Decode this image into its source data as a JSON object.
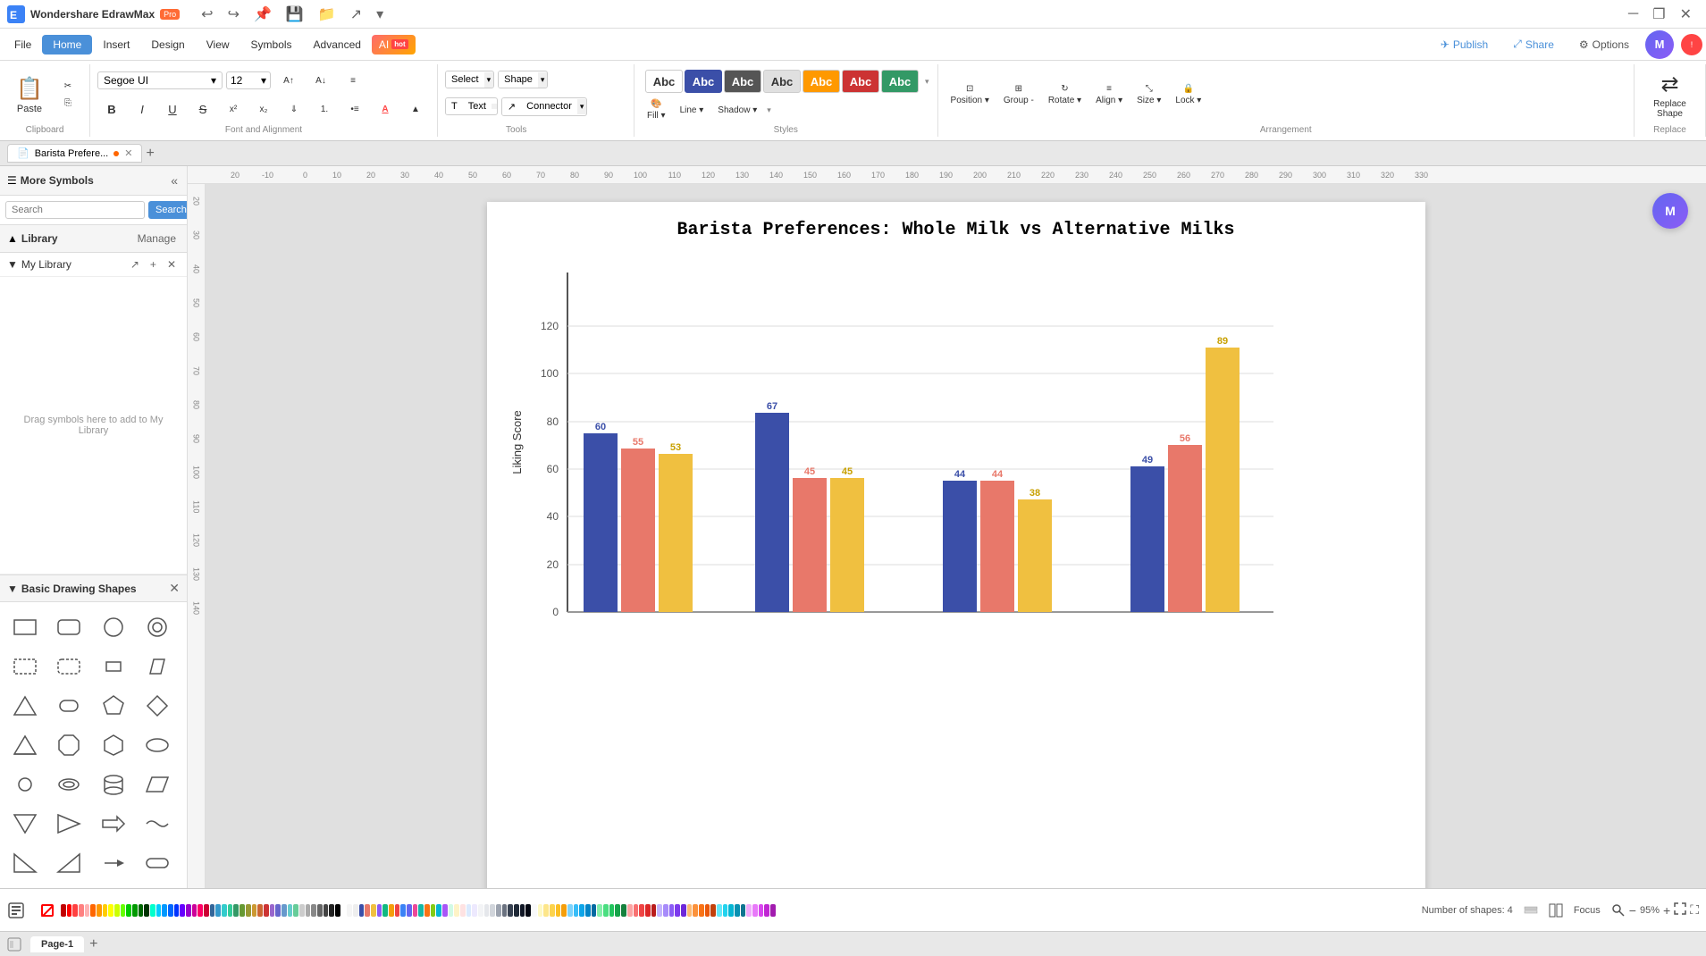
{
  "app": {
    "name": "Wondershare EdrawMax",
    "badge": "Pro",
    "title_bar": {
      "undo": "↩",
      "redo": "↪",
      "add_tab": "＋",
      "save": "💾",
      "folder": "📁",
      "minimize": "─",
      "restore": "❐",
      "close": "✕"
    }
  },
  "menu": {
    "items": [
      "File",
      "Home",
      "Insert",
      "Design",
      "View",
      "Symbols",
      "Advanced"
    ],
    "active": "Home",
    "right_buttons": [
      "Publish",
      "Share",
      "Options"
    ]
  },
  "ribbon": {
    "clipboard": {
      "label": "Clipboard",
      "cut": "✂",
      "copy": "⎘",
      "paste": "📋"
    },
    "font": {
      "label": "Font and Alignment",
      "name": "Segoe UI",
      "size": "12",
      "bold": "B",
      "italic": "I",
      "underline": "U",
      "strikethrough": "S",
      "superscript": "x²",
      "subscript": "x₂",
      "text_wrap": "⇓",
      "list_num": "1.",
      "list_bullet": "•",
      "font_color": "A",
      "highlight": "▲"
    },
    "tools": {
      "label": "Tools",
      "select": "Select",
      "shape": "Shape",
      "text": "Text",
      "connector": "Connector"
    },
    "styles": {
      "label": "Styles",
      "swatches": [
        "Abc",
        "Abc",
        "Abc",
        "Abc",
        "Abc",
        "Abc",
        "Abc"
      ]
    },
    "fill": {
      "label": "Fill ▾",
      "line": "Line ▾",
      "shadow": "Shadow ▾"
    },
    "arrangement": {
      "label": "Arrangement",
      "position": "Position ▾",
      "group": "Group -",
      "rotate": "Rotate ▾",
      "align": "Align ▾",
      "size": "Size ▾",
      "lock": "Lock ▾"
    },
    "replace": {
      "label": "Replace",
      "replace_shape": "Replace Shape"
    }
  },
  "sidebar": {
    "more_symbols": "More Symbols",
    "search_placeholder": "Search",
    "search_btn": "Search",
    "library": "Library",
    "manage": "Manage",
    "my_library": "My Library",
    "drag_text": "Drag symbols here to add to My Library",
    "basic_shapes": "Basic Drawing Shapes",
    "shapes": [
      "rect",
      "round-rect",
      "circle",
      "ring",
      "rect-dashed",
      "round-rect-dashed",
      "small-rect",
      "parallelogram",
      "triangle",
      "round-rect-small",
      "pentagon",
      "diamond",
      "more-triangle",
      "octagon",
      "hexagon",
      "ellipse",
      "small-circle",
      "ring2",
      "cylinder",
      "parallelogram2",
      "triangle2",
      "triangle3",
      "arrow-block",
      "wave",
      "small-triangle",
      "small-triangle2",
      "small-arrow",
      "pill"
    ]
  },
  "tabs": {
    "document": "Barista Prefere...",
    "pages": [
      "Page-1"
    ],
    "active_page": "Page-1"
  },
  "chart": {
    "title": "Barista Preferences: Whole Milk vs Alternative Milks",
    "y_label": "Liking Score",
    "y_max": 120,
    "y_ticks": [
      0,
      20,
      40,
      60,
      80,
      100,
      120
    ],
    "groups": [
      {
        "bars": [
          {
            "value": 60,
            "color": "#3b4fa8"
          },
          {
            "value": 55,
            "color": "#e8786a"
          },
          {
            "value": 53,
            "color": "#f0c040"
          }
        ]
      },
      {
        "bars": [
          {
            "value": 67,
            "color": "#3b4fa8"
          },
          {
            "value": 45,
            "color": "#e8786a"
          },
          {
            "value": 45,
            "color": "#f0c040"
          }
        ]
      },
      {
        "bars": [
          {
            "value": 44,
            "color": "#3b4fa8"
          },
          {
            "value": 44,
            "color": "#e8786a"
          },
          {
            "value": 38,
            "color": "#f0c040"
          }
        ]
      },
      {
        "bars": [
          {
            "value": 49,
            "color": "#3b4fa8"
          },
          {
            "value": 56,
            "color": "#e8786a"
          },
          {
            "value": 89,
            "color": "#f0c040"
          }
        ]
      }
    ]
  },
  "status_bar": {
    "shapes_count": "Number of shapes: 4",
    "focus": "Focus",
    "zoom": "95%"
  },
  "colors": [
    "#c00000",
    "#ff0000",
    "#ff4040",
    "#ff8080",
    "#ffb3b3",
    "#ff6600",
    "#ff9900",
    "#ffcc00",
    "#ffff00",
    "#ccff00",
    "#66ff00",
    "#00cc00",
    "#009900",
    "#006600",
    "#003300",
    "#00ffcc",
    "#00ccff",
    "#0099ff",
    "#0066ff",
    "#0033ff",
    "#6600ff",
    "#9900cc",
    "#cc0099",
    "#ff0066",
    "#cc0033",
    "#336699",
    "#3399cc",
    "#33cccc",
    "#33cc99",
    "#339966",
    "#669933",
    "#999933",
    "#cc9933",
    "#cc6633",
    "#cc3333",
    "#9966cc",
    "#6666cc",
    "#6699cc",
    "#66cccc",
    "#66cc99"
  ]
}
